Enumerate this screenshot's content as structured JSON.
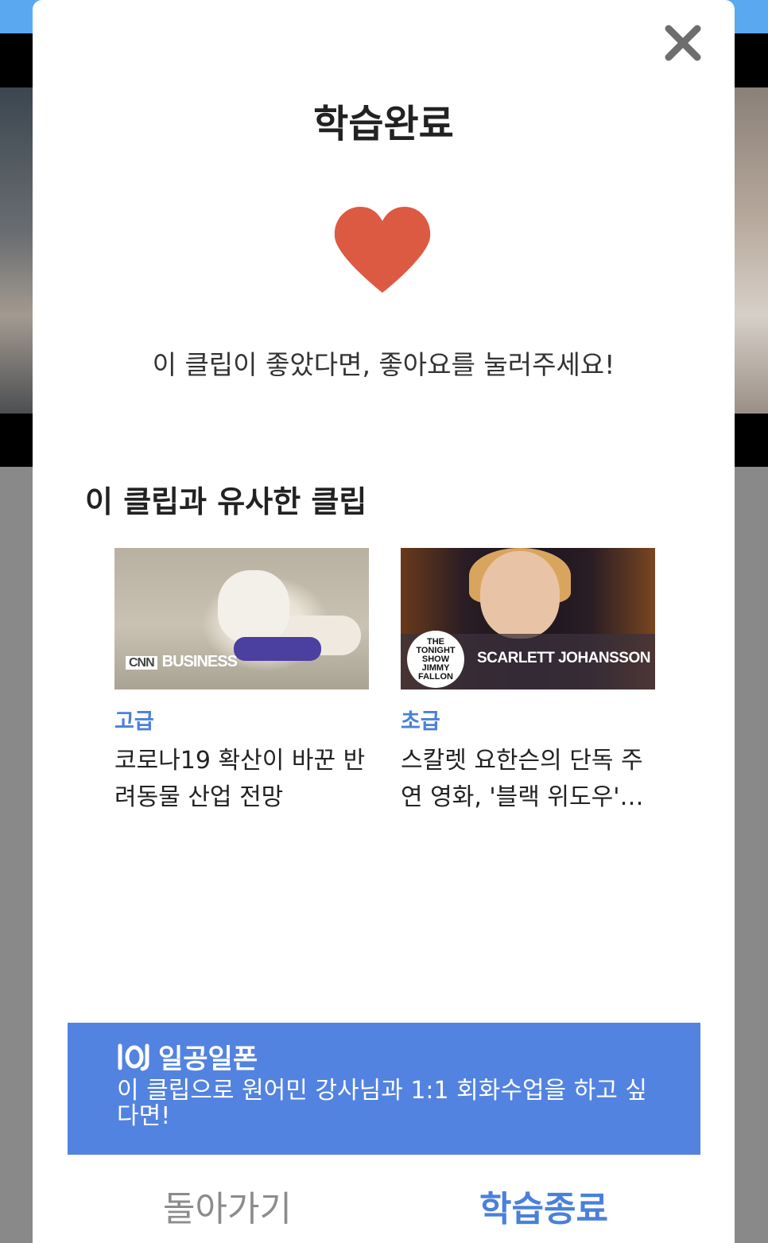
{
  "modal": {
    "title": "학습완료",
    "like_prompt": "이 클립이 좋았다면, 좋아요를 눌러주세요!",
    "section_title": "이 클립과 유사한 클립"
  },
  "clips": [
    {
      "level": "고급",
      "title": "코로나19 확산이 바꾼 반려동물 산업 전망",
      "thumbnail_logo": "BUSINESS",
      "thumbnail_logo_small": "CNN"
    },
    {
      "level": "초급",
      "title": "스칼렛 요한슨의 단독 주연 영화, '블랙 위도우'…",
      "thumbnail_show": "THE TONIGHT SHOW JIMMY FALLON",
      "thumbnail_guest": "SCARLETT JOHANSSON"
    }
  ],
  "banner": {
    "brand": "일공일폰",
    "text": "이 클립으로 원어민 강사님과 1:1 회화수업을 하고 싶다면!"
  },
  "footer": {
    "back_label": "돌아가기",
    "finish_label": "학습종료"
  },
  "colors": {
    "accent": "#4a80dc",
    "banner": "#5383e0",
    "heart": "#dd5a42",
    "topbar": "#5aa9f0"
  },
  "icons": {
    "close": "close-icon",
    "heart": "heart-icon",
    "brand": "brand-logo-icon"
  }
}
